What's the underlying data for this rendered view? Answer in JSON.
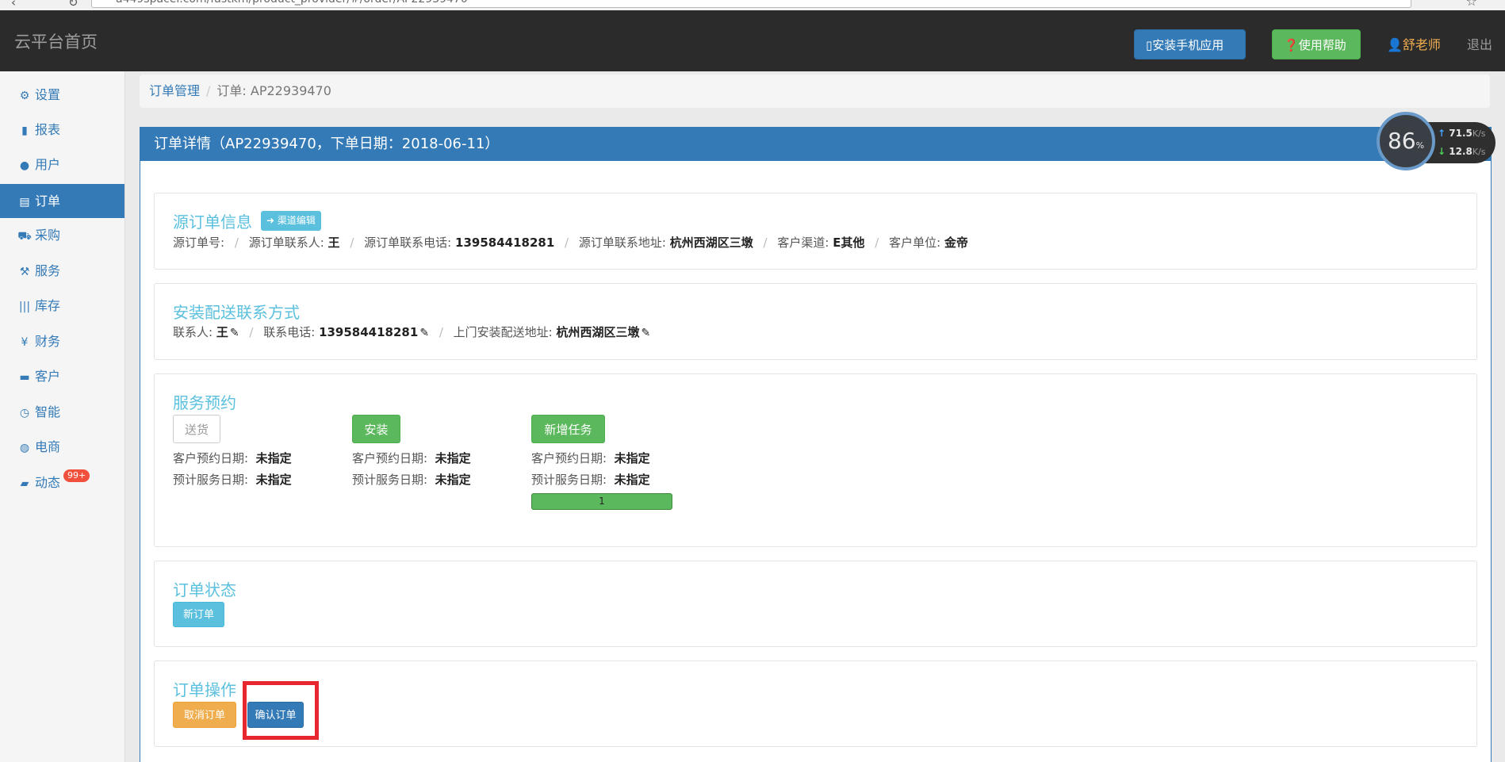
{
  "browser": {
    "url": "a449spacei.com/fastkm/product_provider/#/order/AP22939470"
  },
  "topbar": {
    "brand": "云平台首页",
    "install_app": "安装手机应用",
    "help": "使用帮助",
    "user": "舒老师",
    "logout": "退出"
  },
  "sidebar": {
    "items": [
      {
        "icon": "gear-icon",
        "label": "设置"
      },
      {
        "icon": "bar-chart-icon",
        "label": "报表"
      },
      {
        "icon": "user-icon",
        "label": "用户"
      },
      {
        "icon": "list-icon",
        "label": "订单"
      },
      {
        "icon": "cart-icon",
        "label": "采购"
      },
      {
        "icon": "wrench-icon",
        "label": "服务"
      },
      {
        "icon": "barcode-icon",
        "label": "库存"
      },
      {
        "icon": "yen-icon",
        "label": "财务"
      },
      {
        "icon": "briefcase-icon",
        "label": "客户"
      },
      {
        "icon": "dashboard-icon",
        "label": "智能"
      },
      {
        "icon": "globe-icon",
        "label": "电商"
      },
      {
        "icon": "comment-icon",
        "label": "动态"
      }
    ],
    "active_index": 3,
    "activity_badge": "99+"
  },
  "breadcrumb": {
    "root": "订单管理",
    "current": "订单: AP22939470"
  },
  "panel": {
    "title": "订单详情（AP22939470，下单日期：2018-06-11）"
  },
  "source_order": {
    "title": "源订单信息",
    "channel_edit": "渠道编辑",
    "fields": [
      {
        "label": "源订单号:",
        "value": ""
      },
      {
        "label": "源订单联系人:",
        "value": "王"
      },
      {
        "label": "源订单联系电话:",
        "value": "139584418281"
      },
      {
        "label": "源订单联系地址:",
        "value": "杭州西湖区三墩"
      },
      {
        "label": "客户渠道:",
        "value": "E其他"
      },
      {
        "label": "客户单位:",
        "value": "金帝"
      }
    ]
  },
  "install_contact": {
    "title": "安装配送联系方式",
    "fields": [
      {
        "label": "联系人:",
        "value": "王"
      },
      {
        "label": "联系电话:",
        "value": "139584418281"
      },
      {
        "label": "上门安装配送地址:",
        "value": "杭州西湖区三墩"
      }
    ]
  },
  "service": {
    "title": "服务预约",
    "columns": [
      {
        "button": "送货",
        "customer_date_label": "客户预约日期:",
        "customer_date": "未指定",
        "service_date_label": "预计服务日期:",
        "service_date": "未指定"
      },
      {
        "button": "安装",
        "customer_date_label": "客户预约日期:",
        "customer_date": "未指定",
        "service_date_label": "预计服务日期:",
        "service_date": "未指定"
      },
      {
        "button": "新增任务",
        "customer_date_label": "客户预约日期:",
        "customer_date": "未指定",
        "service_date_label": "预计服务日期:",
        "service_date": "未指定",
        "progress_text": "1"
      }
    ]
  },
  "order_status": {
    "title": "订单状态",
    "status": "新订单"
  },
  "order_actions": {
    "title": "订单操作",
    "cancel": "取消订单",
    "confirm": "确认订单"
  },
  "net_widget": {
    "percent": "86",
    "percent_unit": "%",
    "upload": "71.5",
    "download": "12.8",
    "unit": "K/s"
  },
  "colors": {
    "primary": "#337ab7",
    "success": "#5cb85c",
    "info": "#5bc0de",
    "warning": "#f0ad4e",
    "highlight": "#e8262f"
  }
}
